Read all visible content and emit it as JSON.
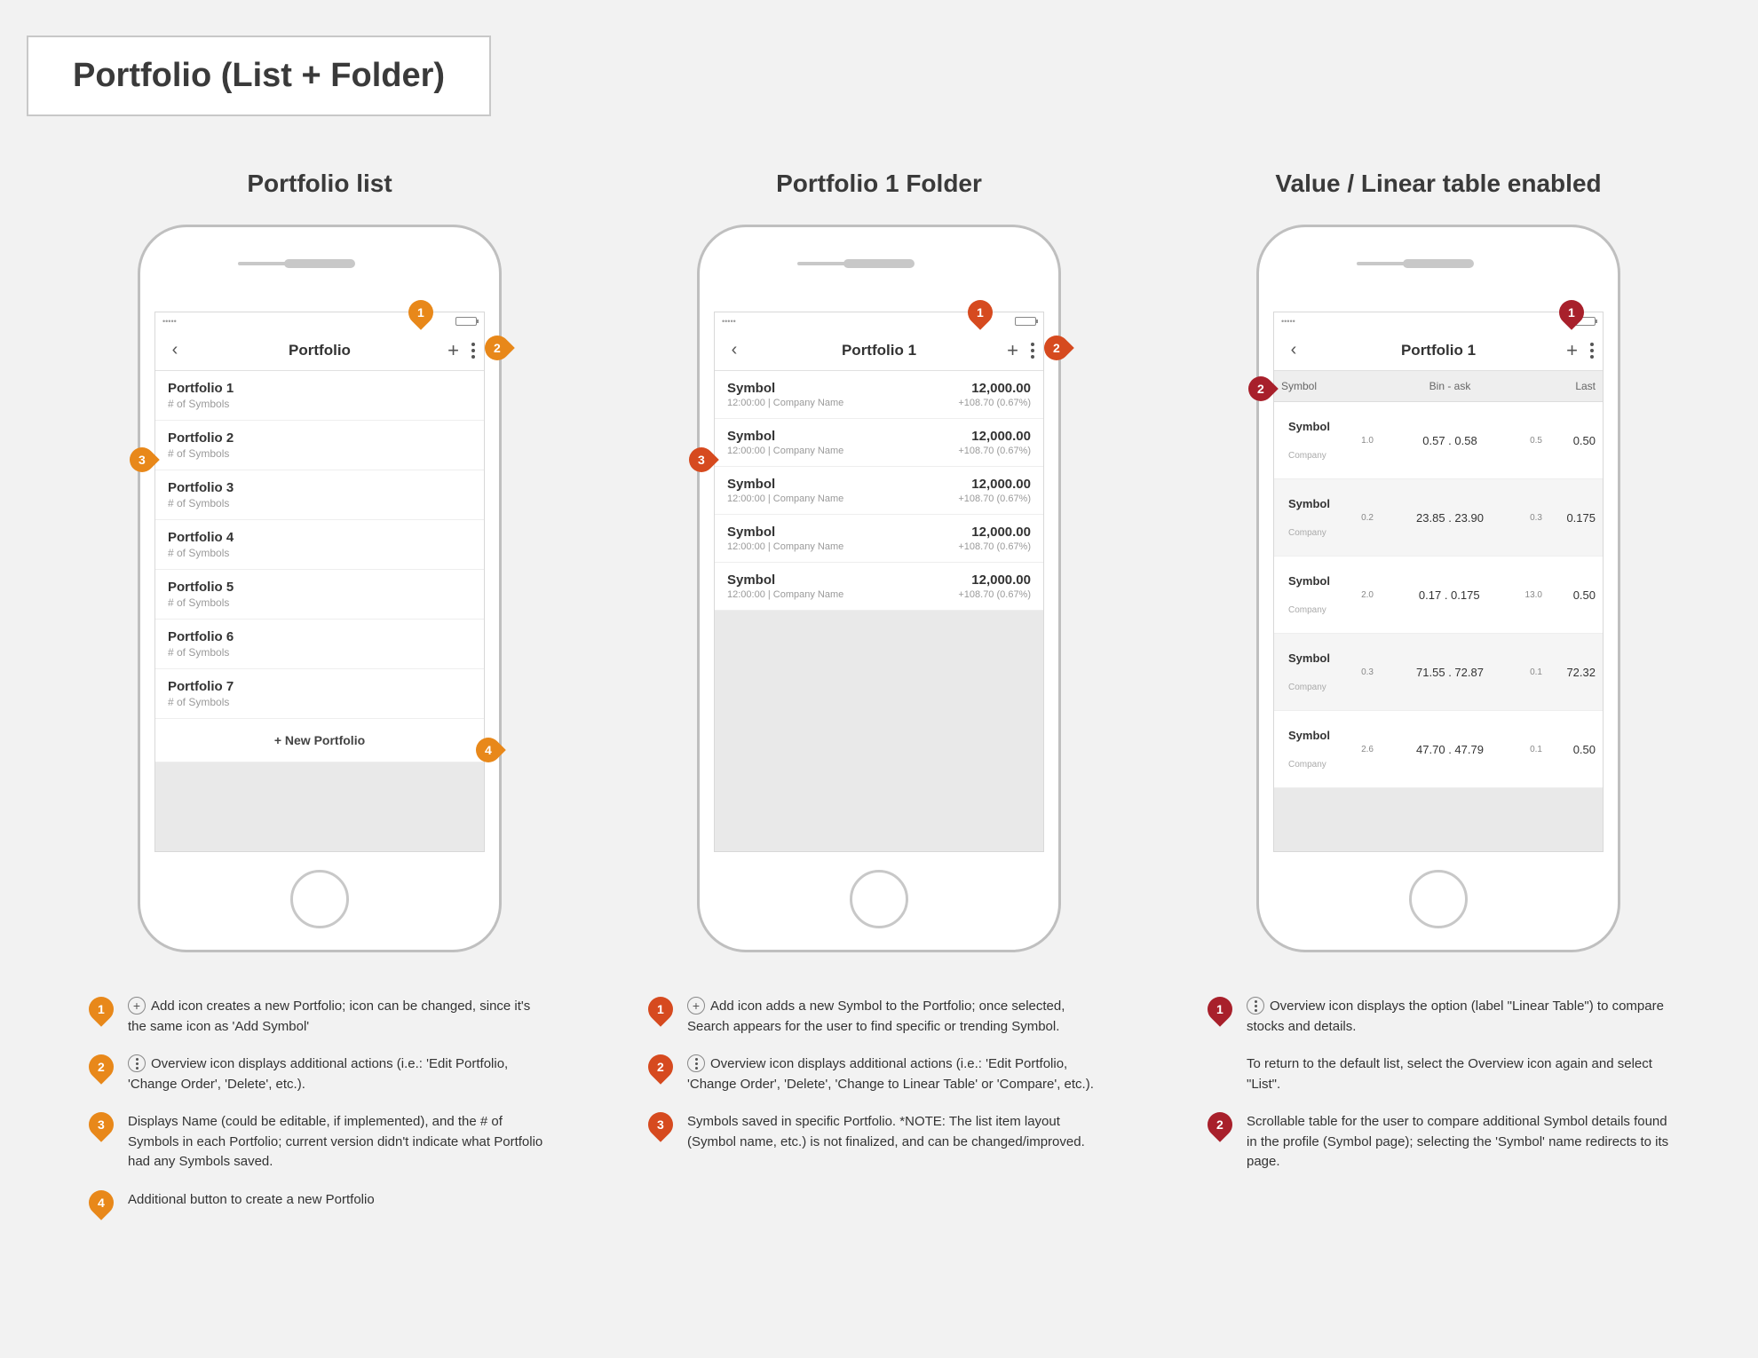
{
  "page_title": "Portfolio (List + Folder)",
  "cols": {
    "a": {
      "title": "Portfolio list",
      "nav_title": "Portfolio",
      "rows": [
        {
          "name": "Portfolio 1",
          "sub": "# of Symbols"
        },
        {
          "name": "Portfolio 2",
          "sub": "# of Symbols"
        },
        {
          "name": "Portfolio 3",
          "sub": "# of Symbols"
        },
        {
          "name": "Portfolio 4",
          "sub": "# of Symbols"
        },
        {
          "name": "Portfolio 5",
          "sub": "# of Symbols"
        },
        {
          "name": "Portfolio 6",
          "sub": "# of Symbols"
        },
        {
          "name": "Portfolio 7",
          "sub": "# of Symbols"
        }
      ],
      "add_label": "+ New Portfolio",
      "legend": [
        {
          "n": "1",
          "icon": "plus",
          "text": "Add icon creates a new Portfolio; icon can be changed, since it's the same icon as 'Add Symbol'"
        },
        {
          "n": "2",
          "icon": "dots",
          "text": "Overview icon displays additional actions (i.e.: 'Edit Portfolio, 'Change Order', 'Delete', etc.)."
        },
        {
          "n": "3",
          "icon": "",
          "text": "Displays Name (could be editable, if implemented), and the # of Symbols in each Portfolio; current version didn't indicate what Portfolio had any Symbols saved."
        },
        {
          "n": "4",
          "icon": "",
          "text": "Additional button to create a new Portfolio"
        }
      ]
    },
    "b": {
      "title": "Portfolio 1 Folder",
      "nav_title": "Portfolio 1",
      "rows": [
        {
          "sym": "Symbol",
          "sub": "12:00:00 | Company Name",
          "val": "12,000.00",
          "chg": "+108.70 (0.67%)"
        },
        {
          "sym": "Symbol",
          "sub": "12:00:00 | Company Name",
          "val": "12,000.00",
          "chg": "+108.70 (0.67%)"
        },
        {
          "sym": "Symbol",
          "sub": "12:00:00 | Company Name",
          "val": "12,000.00",
          "chg": "+108.70 (0.67%)"
        },
        {
          "sym": "Symbol",
          "sub": "12:00:00 | Company Name",
          "val": "12,000.00",
          "chg": "+108.70 (0.67%)"
        },
        {
          "sym": "Symbol",
          "sub": "12:00:00 | Company Name",
          "val": "12,000.00",
          "chg": "+108.70 (0.67%)"
        }
      ],
      "legend": [
        {
          "n": "1",
          "icon": "plus",
          "text": "Add icon adds a new Symbol to the Portfolio; once selected, Search appears for the user to find specific or trending Symbol."
        },
        {
          "n": "2",
          "icon": "dots",
          "text": "Overview icon displays additional actions (i.e.: 'Edit Portfolio, 'Change Order', 'Delete', 'Change to Linear Table' or 'Compare', etc.)."
        },
        {
          "n": "3",
          "icon": "",
          "text": "Symbols saved in specific Portfolio. *NOTE: The list item layout (Symbol name, etc.) is not finalized, and can be changed/improved."
        }
      ]
    },
    "c": {
      "title": "Value / Linear table enabled",
      "nav_title": "Portfolio 1",
      "thead": {
        "c1": "Symbol",
        "c3": "Bin - ask",
        "c5": "Last"
      },
      "rows": [
        {
          "sym": "Symbol",
          "co": "Company",
          "a": "1.0",
          "mid": "0.57 . 0.58",
          "b": "0.5",
          "last": "0.50"
        },
        {
          "sym": "Symbol",
          "co": "Company",
          "a": "0.2",
          "mid": "23.85 . 23.90",
          "b": "0.3",
          "last": "0.175"
        },
        {
          "sym": "Symbol",
          "co": "Company",
          "a": "2.0",
          "mid": "0.17 . 0.175",
          "b": "13.0",
          "last": "0.50"
        },
        {
          "sym": "Symbol",
          "co": "Company",
          "a": "0.3",
          "mid": "71.55 . 72.87",
          "b": "0.1",
          "last": "72.32"
        },
        {
          "sym": "Symbol",
          "co": "Company",
          "a": "2.6",
          "mid": "47.70 . 47.79",
          "b": "0.1",
          "last": "0.50"
        }
      ],
      "legend": [
        {
          "n": "1",
          "icon": "dots",
          "text": "Overview icon displays the option (label \"Linear Table\") to compare stocks and details."
        },
        {
          "n": "",
          "icon": "",
          "text": "To return to the default list, select the Overview icon again and select \"List\"."
        },
        {
          "n": "2",
          "icon": "",
          "text": "Scrollable table for the user to compare additional Symbol details found in the profile (Symbol page); selecting the 'Symbol' name redirects to its page."
        }
      ]
    }
  }
}
